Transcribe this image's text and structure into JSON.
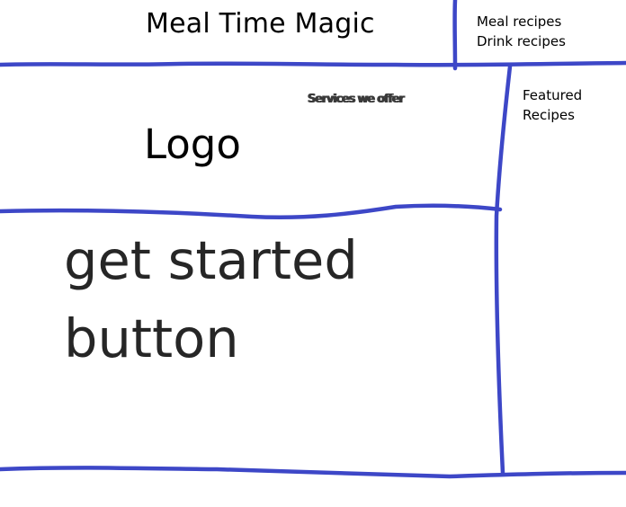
{
  "header": {
    "title": "Meal Time Magic",
    "nav": [
      {
        "label": "Meal recipes"
      },
      {
        "label": "Drink recipes"
      }
    ]
  },
  "hero": {
    "logo_placeholder": "Logo",
    "services_link": "Services we offer",
    "cta_line1": "get started",
    "cta_line2": "button"
  },
  "sidebar": {
    "featured_line1": "Featured",
    "featured_line2": "Recipes"
  },
  "colors": {
    "sketch_line": "#3d47c7",
    "text": "#000000",
    "cta_text": "#262626"
  }
}
